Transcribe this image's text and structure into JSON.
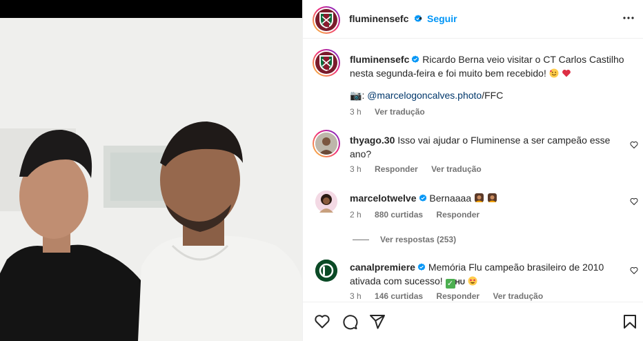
{
  "colors": {
    "accent": "#0095f6",
    "verified": "#0095f6",
    "link": "#00376b",
    "muted": "#737373",
    "text": "#262626"
  },
  "header": {
    "username": "fluminensefc",
    "follow_label": "Seguir",
    "separator": "•"
  },
  "caption": {
    "username": "fluminensefc",
    "text": "Ricardo Berna veio visitar o CT Carlos Castilho nesta segunda-feira e foi muito bem recebido!",
    "camera_icon": "📷",
    "photo_credit": "@marcelogoncalves.photo",
    "photo_credit_suffix": "/FFC",
    "time": "3 h",
    "translate": "Ver tradução"
  },
  "comments": [
    {
      "username": "thyago.30",
      "verified": false,
      "text": "Isso vai ajudar o Fluminense a ser campeão esse ano?",
      "time": "3 h",
      "reply": "Responder",
      "translate": "Ver tradução"
    },
    {
      "username": "marcelotwelve",
      "verified": true,
      "text": "Bernaaaa",
      "time": "2 h",
      "likes": "880 curtidas",
      "reply": "Responder",
      "view_replies": "Ver respostas (253)"
    },
    {
      "username": "canalpremiere",
      "verified": true,
      "text": "Memória Flu campeão brasileiro de 2010 ativada com sucesso!",
      "badge_text": "HU",
      "time": "3 h",
      "likes": "146 curtidas",
      "reply": "Responder",
      "translate": "Ver tradução"
    }
  ],
  "avatar_letters": {
    "canalpremiere": "P"
  },
  "icons": [
    "more-options-icon",
    "verified-icon",
    "heart-icon",
    "comment-icon",
    "share-icon",
    "bookmark-icon"
  ]
}
